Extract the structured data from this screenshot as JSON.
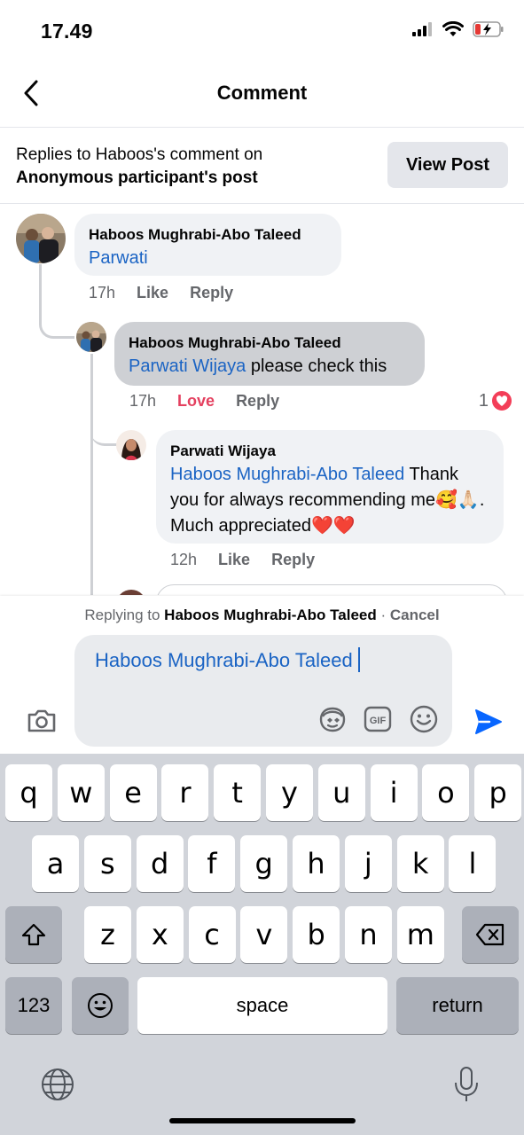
{
  "status": {
    "time": "17.49"
  },
  "header": {
    "title": "Comment"
  },
  "banner": {
    "line1_prefix": "Replies to Haboos's comment on",
    "participant": "Anonymous participant",
    "post_suffix": "'s post",
    "view_post_label": "View Post"
  },
  "comments": [
    {
      "author": "Haboos Mughrabi-Abo Taleed",
      "mention": "Parwati",
      "text": "",
      "time": "17h",
      "like_label": "Like",
      "reply_label": "Reply"
    },
    {
      "author": "Haboos Mughrabi-Abo Taleed",
      "mention": "Parwati Wijaya",
      "text": " please check this",
      "time": "17h",
      "like_label": "Love",
      "reply_label": "Reply",
      "reaction_count": "1"
    },
    {
      "author": "Parwati Wijaya",
      "mention": "Haboos Mughrabi-Abo Taleed",
      "text": " Thank you for always recommending me🥰🙏🏻. Much appreciated❤️❤️",
      "time": "12h",
      "like_label": "Like",
      "reply_label": "Reply"
    }
  ],
  "composer": {
    "replying_prefix": "Replying to ",
    "replying_name": "Haboos Mughrabi-Abo Taleed",
    "separator": " · ",
    "cancel_label": "Cancel",
    "input_value": "Haboos Mughrabi-Abo Taleed"
  },
  "keyboard": {
    "row1": [
      "q",
      "w",
      "e",
      "r",
      "t",
      "y",
      "u",
      "i",
      "o",
      "p"
    ],
    "row2": [
      "a",
      "s",
      "d",
      "f",
      "g",
      "h",
      "j",
      "k",
      "l"
    ],
    "row3": [
      "z",
      "x",
      "c",
      "v",
      "b",
      "n",
      "m"
    ],
    "numbers_label": "123",
    "space_label": "space",
    "return_label": "return"
  },
  "colors": {
    "accent": "#1b64c4",
    "love": "#e4405f",
    "send": "#0866ff"
  }
}
